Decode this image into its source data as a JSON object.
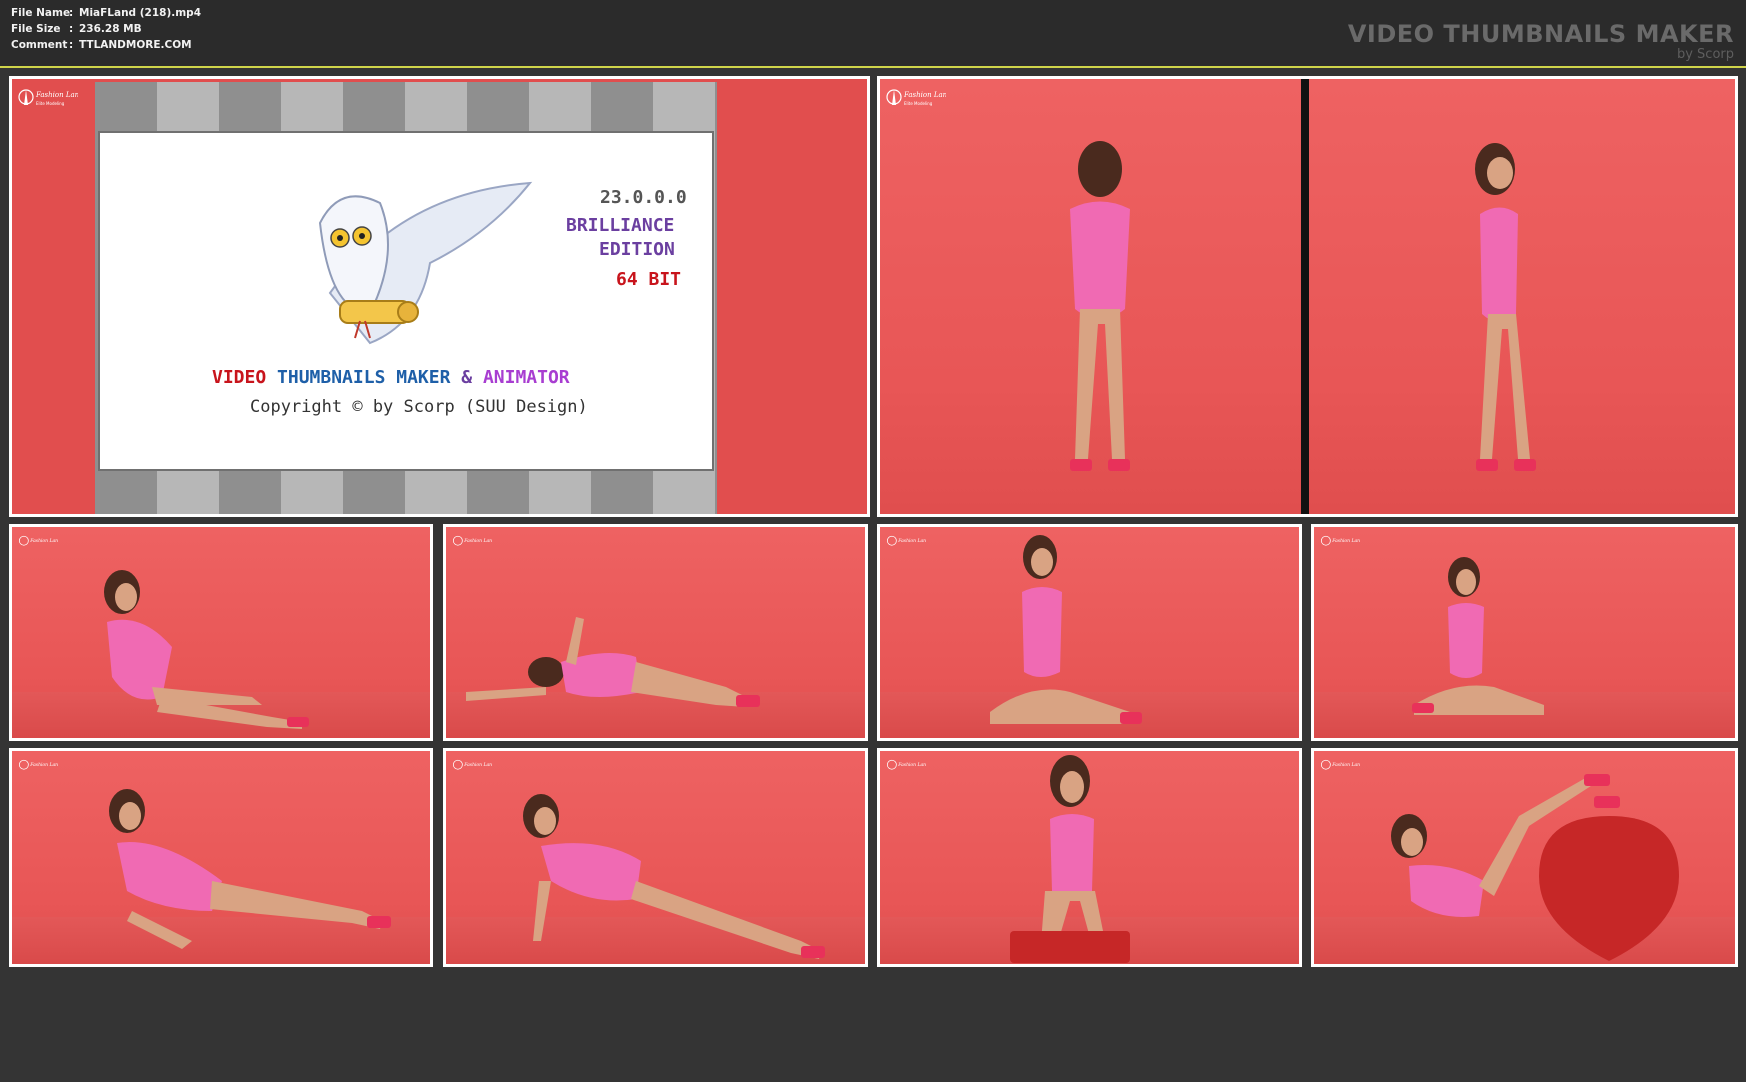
{
  "header": {
    "rows": [
      {
        "key": "File Name",
        "sep": ":",
        "value": "MiaFLand (218).mp4"
      },
      {
        "key": "File Size",
        "sep": ":",
        "value": "236.28 MB"
      },
      {
        "key": "Comment",
        "sep": ":",
        "value": "TTLANDMORE.COM"
      }
    ],
    "brand_title": "VIDEO THUMBNAILS MAKER",
    "brand_sub": "by Scorp"
  },
  "splash": {
    "version": "23.0.0.0",
    "edition_line1": "BRILLIANCE",
    "edition_line2": "EDITION",
    "bits": "64 BIT",
    "product_word1": "VIDEO",
    "product_word2": "THUMBNAILS MAKER",
    "product_word3": "&",
    "product_word4": "ANIMATOR",
    "copyright": "Copyright © by Scorp (SUU Design)"
  },
  "colors": {
    "accent_border": "#cfd44a",
    "backdrop": "#e95a5a",
    "swimsuit": "#f06ab3",
    "shoes": "#e8315a"
  },
  "thumbnails": [
    {
      "id": "t-large-1",
      "pose": "standing-back"
    },
    {
      "id": "t-large-2",
      "pose": "standing-side"
    },
    {
      "id": "t1",
      "pose": "reclining"
    },
    {
      "id": "t2",
      "pose": "lying-wave"
    },
    {
      "id": "t3",
      "pose": "kneeling"
    },
    {
      "id": "t4",
      "pose": "kneeling-hand-hair"
    },
    {
      "id": "t5",
      "pose": "lying-side"
    },
    {
      "id": "t6",
      "pose": "lying-hand-face"
    },
    {
      "id": "t7",
      "pose": "sitting-stool"
    },
    {
      "id": "t8",
      "pose": "legs-on-heart"
    }
  ]
}
